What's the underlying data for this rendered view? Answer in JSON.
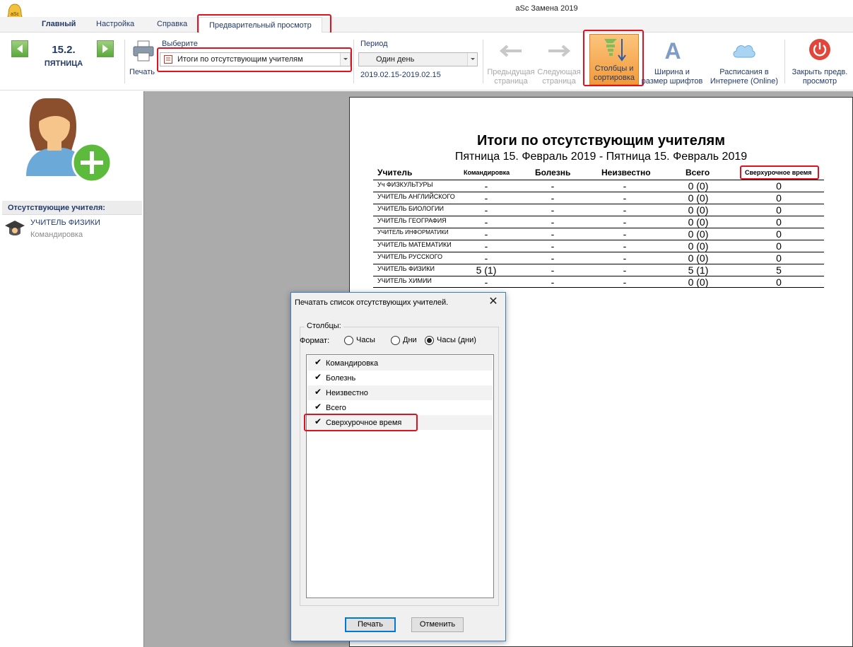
{
  "app": {
    "title": "aSc Замена 2019"
  },
  "tabs": [
    {
      "label": "Главный"
    },
    {
      "label": "Настройка"
    },
    {
      "label": "Справка"
    },
    {
      "label": "Предварительный просмотр"
    }
  ],
  "ribbon": {
    "date": "15.2.",
    "weekday": "ПЯТНИЦА",
    "print_label": "Печать",
    "select_label": "Выберите",
    "select_value": "Итоги по отсутствующим учителям",
    "period_label": "Период",
    "period_value": "Один день",
    "period_range": "2019.02.15-2019.02.15",
    "buttons": [
      {
        "line1": "Предыдущая",
        "line2": "страница",
        "icon": "arrow-left-icon"
      },
      {
        "line1": "Следующая",
        "line2": "страница",
        "icon": "arrow-right-icon"
      },
      {
        "line1": "Столбцы и",
        "line2": "сортировка",
        "icon": "columns-sort-icon"
      },
      {
        "line1": "Ширина и",
        "line2": "размер шрифтов",
        "icon": "font-icon"
      },
      {
        "line1": "Расписания в",
        "line2": "Интернете (Online)",
        "icon": "cloud-icon"
      },
      {
        "line1": "Закрыть предв.",
        "line2": "просмотр",
        "icon": "power-icon"
      }
    ]
  },
  "left_panel": {
    "header": "Отсутствующие учителя:",
    "teacher_name": "УЧИТЕЛЬ ФИЗИКИ",
    "teacher_status": "Командировка"
  },
  "report": {
    "title": "Итоги по отсутствующим учителям",
    "subtitle": "Пятница 15. Февраль 2019 - Пятница 15. Февраль 2019",
    "columns": [
      "Учитель",
      "Командировка",
      "Болезнь",
      "Неизвестно",
      "Всего",
      "Сверхурочное время"
    ],
    "rows": [
      {
        "teacher": "Уч ФИЗКУЛЬТУРЫ",
        "trip": "-",
        "sick": "-",
        "unknown": "-",
        "total": "0 (0)",
        "overtime": "0"
      },
      {
        "teacher": "УЧИТЕЛЬ АНГЛИЙСКОГО",
        "trip": "-",
        "sick": "-",
        "unknown": "-",
        "total": "0 (0)",
        "overtime": "0"
      },
      {
        "teacher": "УЧИТЕЛЬ БИОЛОГИИ",
        "trip": "-",
        "sick": "-",
        "unknown": "-",
        "total": "0 (0)",
        "overtime": "0"
      },
      {
        "teacher": "УЧИТЕЛЬ ГЕОГРАФИЯ",
        "trip": "-",
        "sick": "-",
        "unknown": "-",
        "total": "0 (0)",
        "overtime": "0"
      },
      {
        "teacher": "УЧИТЕЛЬ ИНФОРМАТИКИ",
        "trip": "-",
        "sick": "-",
        "unknown": "-",
        "total": "0 (0)",
        "overtime": "0"
      },
      {
        "teacher": "УЧИТЕЛЬ МАТЕМАТИКИ",
        "trip": "-",
        "sick": "-",
        "unknown": "-",
        "total": "0 (0)",
        "overtime": "0"
      },
      {
        "teacher": "УЧИТЕЛЬ РУССКОГО",
        "trip": "-",
        "sick": "-",
        "unknown": "-",
        "total": "0 (0)",
        "overtime": "0"
      },
      {
        "teacher": "УЧИТЕЛЬ ФИЗИКИ",
        "trip": "5 (1)",
        "sick": "-",
        "unknown": "-",
        "total": "5 (1)",
        "overtime": "5"
      },
      {
        "teacher": "УЧИТЕЛЬ ХИМИИ",
        "trip": "-",
        "sick": "-",
        "unknown": "-",
        "total": "0 (0)",
        "overtime": "0"
      }
    ]
  },
  "dialog": {
    "title": "Печатать список отсутствующих учителей.",
    "close": "✕",
    "group_label": "Столбцы:",
    "format_label": "Формат:",
    "formats": [
      {
        "label": "Часы",
        "checked": false
      },
      {
        "label": "Дни",
        "checked": false
      },
      {
        "label": "Часы (дни)",
        "checked": true
      }
    ],
    "columns": [
      {
        "label": "Командировка",
        "checked": true
      },
      {
        "label": "Болезнь",
        "checked": true
      },
      {
        "label": "Неизвестно",
        "checked": true
      },
      {
        "label": "Всего",
        "checked": true
      },
      {
        "label": "Сверхурочное время",
        "checked": true
      }
    ],
    "ok_label": "Печать",
    "cancel_label": "Отменить"
  },
  "colors": {
    "accent": "#223a6b",
    "highlight": "#e0121f",
    "active_button": "#f6a94a",
    "preview_bg": "#ababab"
  }
}
